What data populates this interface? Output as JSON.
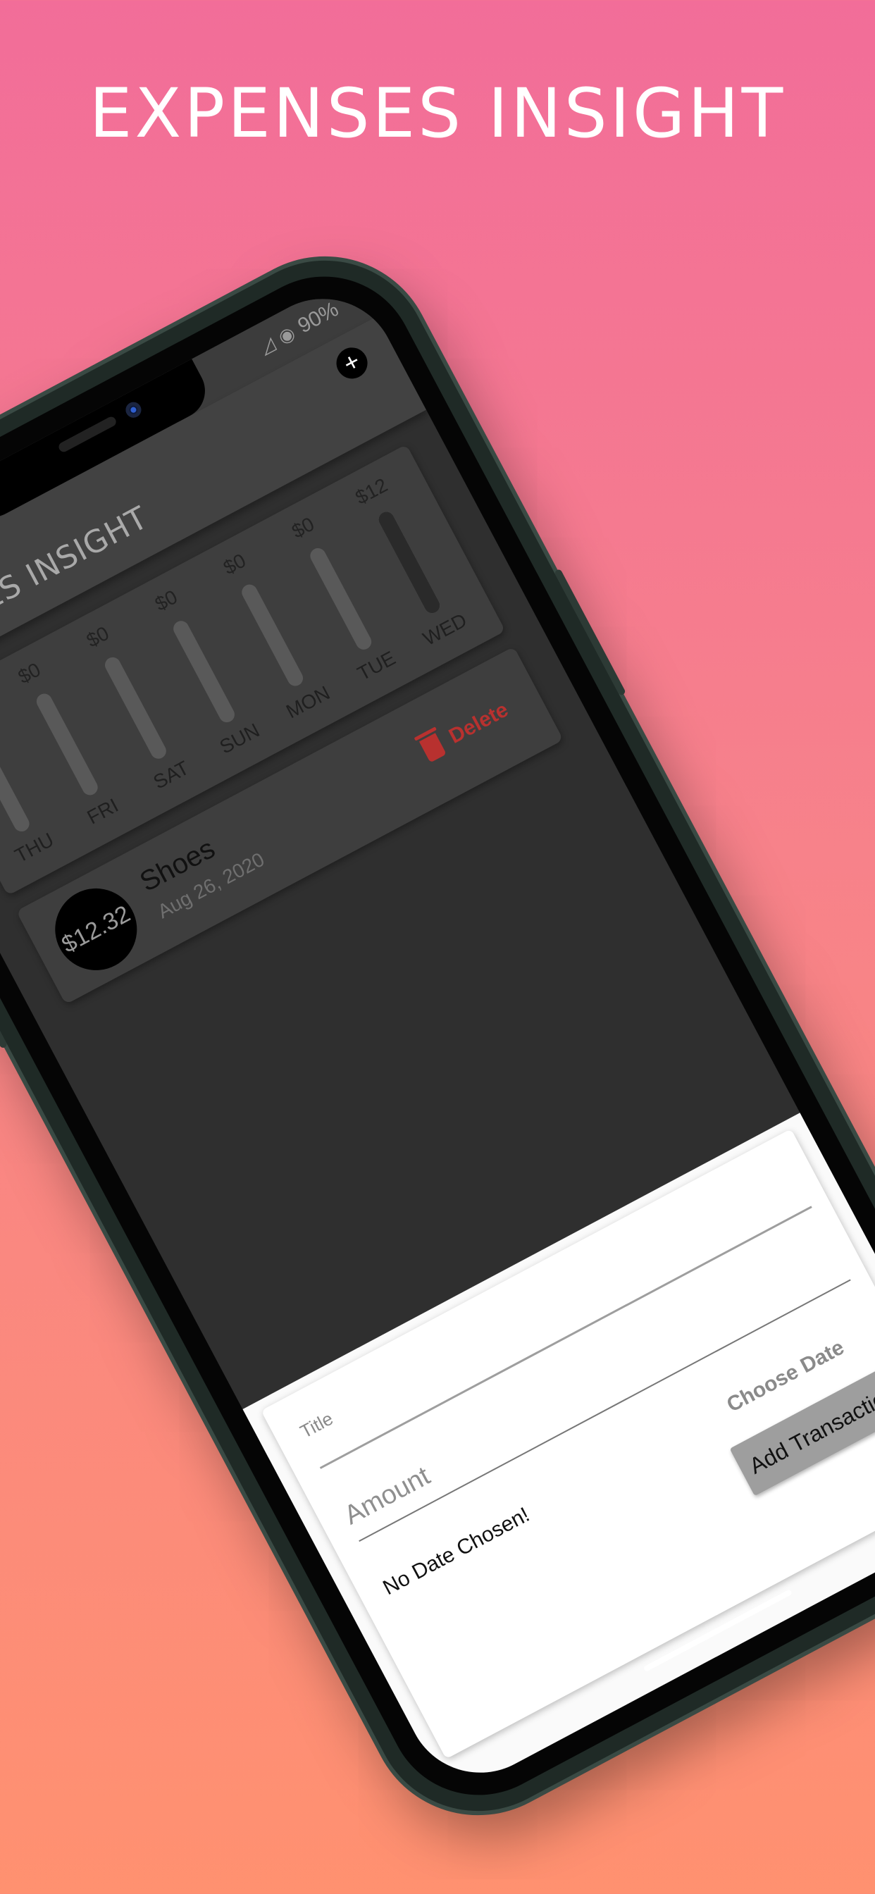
{
  "headline": "EXPENSES INSIGHT",
  "status": {
    "battery": "90%"
  },
  "appbar": {
    "title": "EXPENSES INSIGHT",
    "add_label": "+"
  },
  "chart": {
    "bars": [
      {
        "amount": "$0",
        "day": "THU",
        "fraction": 0
      },
      {
        "amount": "$0",
        "day": "FRI",
        "fraction": 0
      },
      {
        "amount": "$0",
        "day": "SAT",
        "fraction": 0
      },
      {
        "amount": "$0",
        "day": "SUN",
        "fraction": 0
      },
      {
        "amount": "$0",
        "day": "MON",
        "fraction": 0
      },
      {
        "amount": "$0",
        "day": "TUE",
        "fraction": 0
      },
      {
        "amount": "$12",
        "day": "WED",
        "fraction": 1
      }
    ]
  },
  "transaction": {
    "amount": "$12.32",
    "title": "Shoes",
    "date": "Aug 26, 2020",
    "delete_label": "Delete"
  },
  "form": {
    "title_label": "Title",
    "amount_placeholder": "Amount",
    "no_date": "No Date Chosen!",
    "choose_date": "Choose Date",
    "add_button": "Add Transaction"
  },
  "colors": {
    "accent_delete": "#b8312f",
    "background_top": "#f26d99",
    "background_bottom": "#ff9170"
  }
}
